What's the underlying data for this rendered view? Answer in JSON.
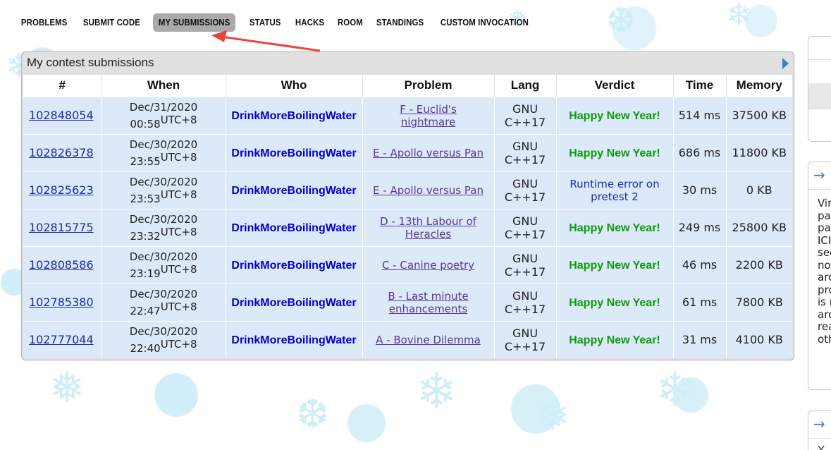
{
  "nav": {
    "items": [
      {
        "label": "PROBLEMS",
        "active": false
      },
      {
        "label": "SUBMIT CODE",
        "active": false
      },
      {
        "label": "MY SUBMISSIONS",
        "active": true
      },
      {
        "label": "STATUS",
        "active": false
      },
      {
        "label": "HACKS",
        "active": false
      },
      {
        "label": "ROOM",
        "active": false
      },
      {
        "label": "STANDINGS",
        "active": false
      },
      {
        "label": "CUSTOM INVOCATION",
        "active": false
      }
    ]
  },
  "submissions": {
    "title": "My contest submissions",
    "headers": [
      "#",
      "When",
      "Who",
      "Problem",
      "Lang",
      "Verdict",
      "Time",
      "Memory"
    ],
    "rows": [
      {
        "id": "102848054",
        "date": "Dec/31/2020",
        "time": "00:58",
        "tz": "UTC+8",
        "who": "DrinkMoreBoilingWater",
        "problem": "F - Euclid's nightmare",
        "lang": "GNU C++17",
        "verdict": "Happy New Year!",
        "verdict_ok": true,
        "run_time": "514 ms",
        "memory": "37500 KB"
      },
      {
        "id": "102826378",
        "date": "Dec/30/2020",
        "time": "23:55",
        "tz": "UTC+8",
        "who": "DrinkMoreBoilingWater",
        "problem": "E - Apollo versus Pan",
        "lang": "GNU C++17",
        "verdict": "Happy New Year!",
        "verdict_ok": true,
        "run_time": "686 ms",
        "memory": "11800 KB"
      },
      {
        "id": "102825623",
        "date": "Dec/30/2020",
        "time": "23:53",
        "tz": "UTC+8",
        "who": "DrinkMoreBoilingWater",
        "problem": "E - Apollo versus Pan",
        "lang": "GNU C++17",
        "verdict": "Runtime error on pretest 2",
        "verdict_ok": false,
        "run_time": "30 ms",
        "memory": "0 KB"
      },
      {
        "id": "102815775",
        "date": "Dec/30/2020",
        "time": "23:32",
        "tz": "UTC+8",
        "who": "DrinkMoreBoilingWater",
        "problem": "D - 13th Labour of Heracles",
        "lang": "GNU C++17",
        "verdict": "Happy New Year!",
        "verdict_ok": true,
        "run_time": "249 ms",
        "memory": "25800 KB"
      },
      {
        "id": "102808586",
        "date": "Dec/30/2020",
        "time": "23:19",
        "tz": "UTC+8",
        "who": "DrinkMoreBoilingWater",
        "problem": "C - Canine poetry",
        "lang": "GNU C++17",
        "verdict": "Happy New Year!",
        "verdict_ok": true,
        "run_time": "46 ms",
        "memory": "2200 KB"
      },
      {
        "id": "102785380",
        "date": "Dec/30/2020",
        "time": "22:47",
        "tz": "UTC+8",
        "who": "DrinkMoreBoilingWater",
        "problem": "B - Last minute enhancements",
        "lang": "GNU C++17",
        "verdict": "Happy New Year!",
        "verdict_ok": true,
        "run_time": "61 ms",
        "memory": "7800 KB"
      },
      {
        "id": "102777044",
        "date": "Dec/30/2020",
        "time": "22:40",
        "tz": "UTC+8",
        "who": "DrinkMoreBoilingWater",
        "problem": "A - Bovine Dilemma",
        "lang": "GNU C++17",
        "verdict": "Happy New Year!",
        "verdict_ok": true,
        "run_time": "31 ms",
        "memory": "4100 KB"
      }
    ]
  },
  "sidebar": {
    "arrow_glyph": "→",
    "partial_text": "Vir\npa\npa\nICI\nsec\nno\narc\npro\nis r\narc\nrea\noth",
    "partial_text_2": "Y"
  },
  "colors": {
    "accepted": "#109c0a",
    "runtime_error": "#1d2ba4",
    "handle": "#0000cc",
    "active_tab": "#aaaaaa",
    "row_bg": "#dbe9f9",
    "arrow_annotation": "#e8453c"
  }
}
